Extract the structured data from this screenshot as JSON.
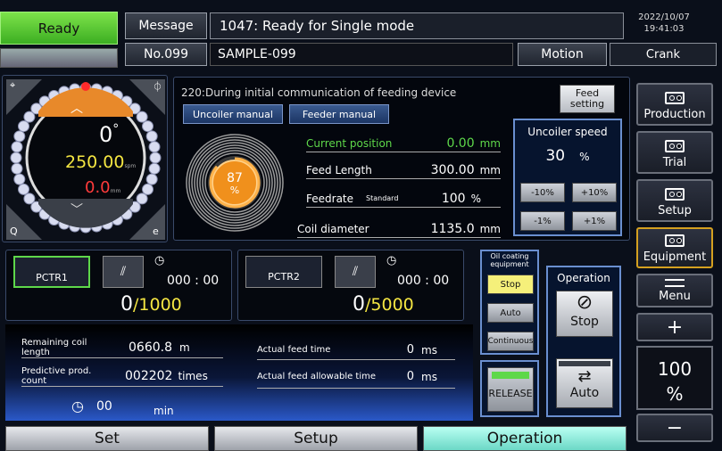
{
  "header": {
    "status": "Ready",
    "message_label": "Message",
    "message_text": "1047: Ready for Single mode",
    "date": "2022/10/07",
    "time": "19:41:03",
    "program_no": "No.099",
    "program_name": "SAMPLE-099",
    "motion_label": "Motion",
    "motion_value": "Crank"
  },
  "dial": {
    "angle": "0",
    "degree_symbol": "°",
    "speed": "250.00",
    "speed_unit": "spm",
    "value": "0.0",
    "value_unit": "mm"
  },
  "feeder": {
    "info": "220:During initial communication of feeding device",
    "uncoiler_manual": "Uncoiler manual",
    "feeder_manual": "Feeder manual",
    "feed_setting": "Feed setting",
    "coil_percent": "87",
    "coil_percent_unit": "%",
    "current_position_label": "Current position",
    "current_position_value": "0.00",
    "current_position_unit": "mm",
    "feed_length_label": "Feed Length",
    "feed_length_value": "300.00",
    "feed_length_unit": "mm",
    "feedrate_label": "Feedrate",
    "feedrate_mode": "Standard",
    "feedrate_value": "100",
    "feedrate_unit": "%",
    "coil_diameter_label": "Coil diameter",
    "coil_diameter_value": "1135.0",
    "coil_diameter_unit": "mm"
  },
  "uncoiler": {
    "title": "Uncoiler speed",
    "value": "30",
    "unit": "%",
    "btn_m10": "-10%",
    "btn_p10": "+10%",
    "btn_m1": "-1%",
    "btn_p1": "+1%"
  },
  "counter1": {
    "name": "PCTR1",
    "time": "000 : 00",
    "count": "0",
    "target": "/1000"
  },
  "counter2": {
    "name": "PCTR2",
    "time": "000 : 00",
    "count": "0",
    "target": "/5000"
  },
  "oil": {
    "title": "Oil coating equipment",
    "stop": "Stop",
    "auto": "Auto",
    "continuous": "Continuous"
  },
  "release": "RELEASE",
  "operation": {
    "title": "Operation",
    "stop": "Stop",
    "auto": "Auto"
  },
  "bottom_info": {
    "remaining_coil_label": "Remaining coil length",
    "remaining_coil_value": "0660.8",
    "remaining_coil_unit": "m",
    "predictive_label": "Predictive prod. count",
    "predictive_value": "002202",
    "predictive_unit": "times",
    "actual_feed_time_label": "Actual feed time",
    "actual_feed_time_value": "0",
    "actual_feed_time_unit": "ms",
    "allowable_label": "Actual feed allowable time",
    "allowable_value": "0",
    "allowable_unit": "ms",
    "timer_value": "00",
    "timer_unit": "min"
  },
  "side": {
    "production": "Production",
    "trial": "Trial",
    "setup": "Setup",
    "equipment": "Equipment",
    "menu": "Menu",
    "plus": "+",
    "percent": "100",
    "percent_unit": "%",
    "minus": "−"
  },
  "tabs": {
    "set": "Set",
    "setup": "Setup",
    "operation": "Operation"
  },
  "colors": {
    "ready_green": "#4cc22e",
    "accent_orange": "#e88a2a",
    "value_yellow": "#f5e642",
    "value_red": "#ff3b3b",
    "label_green": "#5ed84a",
    "tab_active": "#8ff0e0"
  }
}
